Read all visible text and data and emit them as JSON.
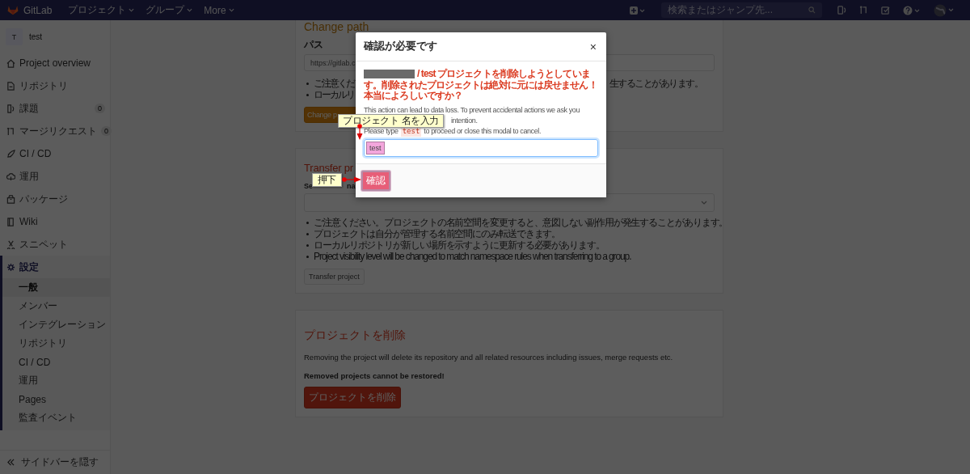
{
  "navbar": {
    "brand": "GitLab",
    "menus": [
      {
        "label": "プロジェクト"
      },
      {
        "label": "グループ"
      },
      {
        "label": "More"
      }
    ],
    "search": {
      "placeholder": "検索またはジャンプ先..."
    }
  },
  "sidebar": {
    "project": {
      "avatar": "T",
      "name": "test"
    },
    "items": [
      {
        "label": "Project overview",
        "selected": false
      },
      {
        "label": "リポジトリ",
        "selected": false
      },
      {
        "label": "課題",
        "count": "0",
        "selected": false
      },
      {
        "label": "マージリクエスト",
        "count": "0",
        "selected": false
      },
      {
        "label": "CI / CD",
        "selected": false
      },
      {
        "label": "運用",
        "selected": false
      },
      {
        "label": "パッケージ",
        "selected": false
      },
      {
        "label": "Wiki",
        "selected": false
      },
      {
        "label": "スニペット",
        "selected": false
      },
      {
        "label": "設定",
        "selected": true,
        "children": [
          {
            "label": "一般",
            "selected": true
          },
          {
            "label": "メンバー",
            "selected": false
          },
          {
            "label": "インテグレーション",
            "selected": false
          },
          {
            "label": "リポジトリ",
            "selected": false
          },
          {
            "label": "CI / CD",
            "selected": false
          },
          {
            "label": "運用",
            "selected": false
          },
          {
            "label": "Pages",
            "selected": false
          },
          {
            "label": "監査イベント",
            "selected": false
          }
        ]
      }
    ],
    "collapse": "サイドバーを隠す"
  },
  "change_path": {
    "title": "Change path",
    "label": "パス",
    "value": "https://gitlab.c",
    "bullets": [
      {
        "left": "ご注意くだ",
        "right": "生することがあります。"
      },
      {
        "left": "ローカルリ"
      }
    ],
    "button": "Change p"
  },
  "transfer": {
    "title": "Transfer pr",
    "label_parts": [
      "Se",
      "na"
    ],
    "bullets": [
      "ご注意ください。プロジェクトの名前空間を変更すると、意図しない副作用が発生することがあります。",
      "プロジェクトは自分が管理する名前空間にのみ転送できます。",
      "ローカルリポジトリが新しい場所を示すように更新する必要があります。",
      "Project visibility level will be changed to match namespace rules when transferring to a group."
    ],
    "button": "Transfer project"
  },
  "delete": {
    "title": "プロジェクトを削除",
    "description": "Removing the project will delete its repository and all related resources including issues, merge requests etc.",
    "warning": "Removed projects cannot be restored!",
    "button": "プロジェクトを削除"
  },
  "modal": {
    "title": "確認が必要です",
    "close": "×",
    "warning": "/ test プロジェクトを削除しようとしています。削除されたプロジェクトは絶対に元には戻せません！本当によろしいですか？",
    "lines": [
      "This action can lead to data loss. To prevent accidental actions we ask you",
      "intention."
    ],
    "prompt": {
      "before": "Please type",
      "code": "test",
      "after": "to proceed or close this modal to cancel."
    },
    "input_value": "test",
    "confirm": "確認"
  },
  "callouts": [
    {
      "text": "プロジェクト 名を入力",
      "kind": "down"
    },
    {
      "text": "押下",
      "kind": "right"
    }
  ]
}
